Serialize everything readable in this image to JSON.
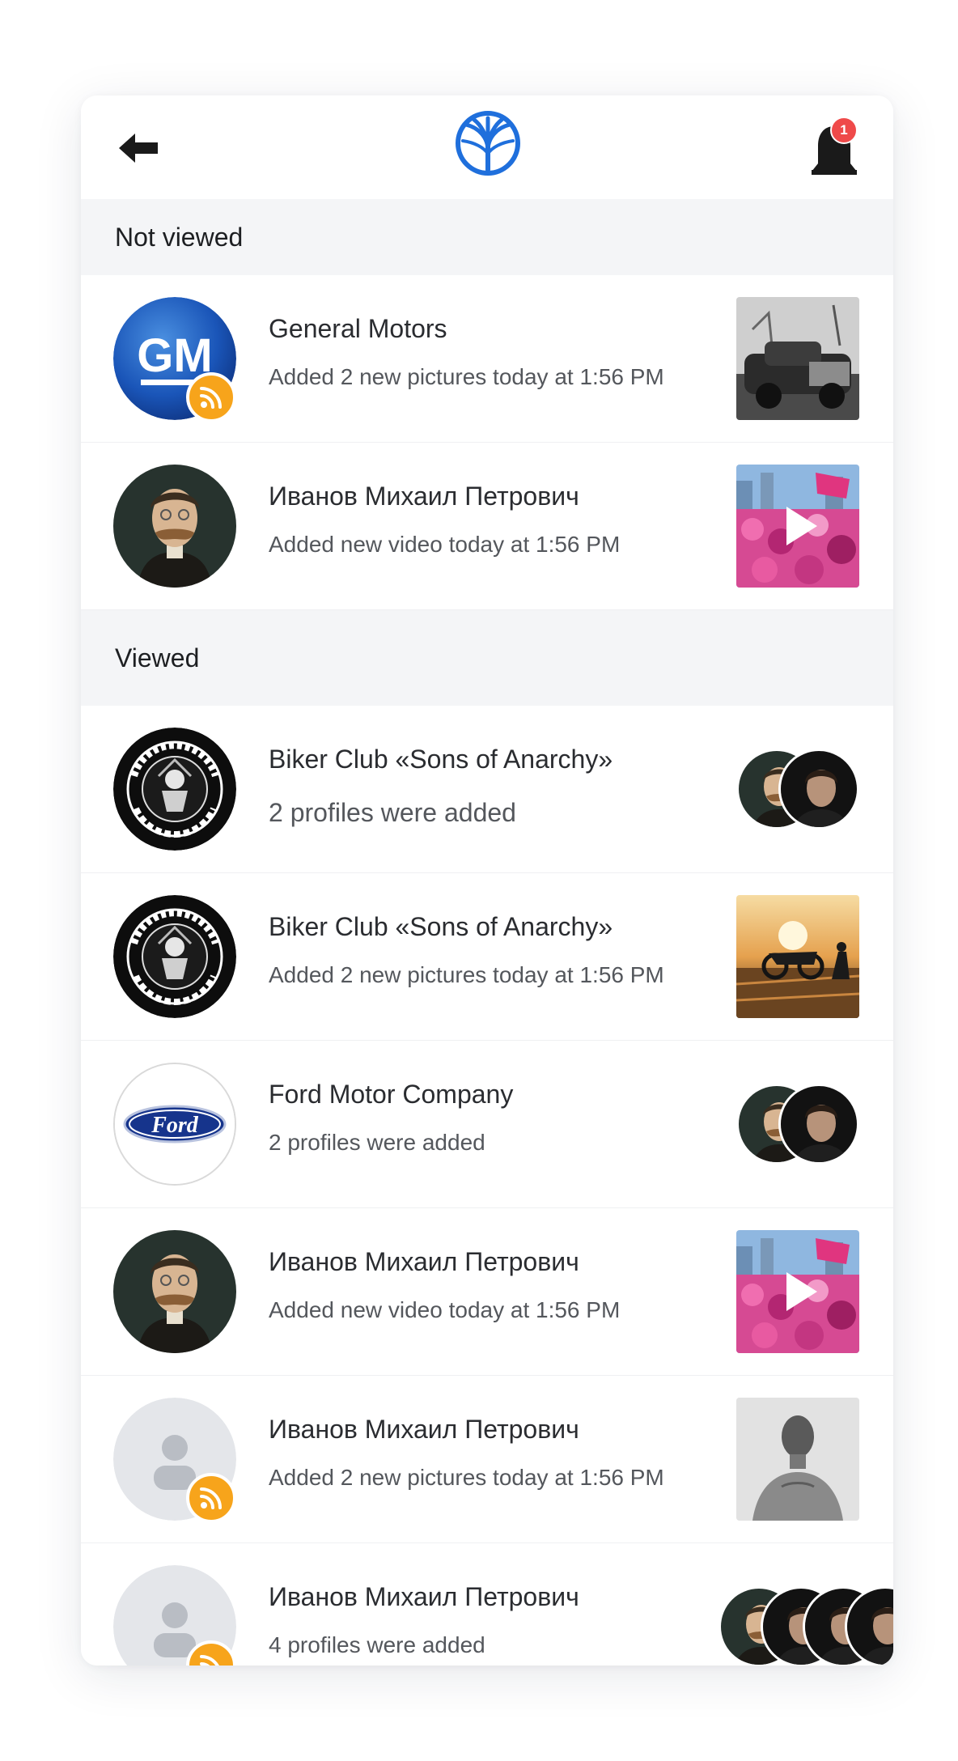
{
  "colors": {
    "accent": "#1f6fdc",
    "rss": "#f7a41b",
    "badge": "#ef4a4a",
    "section_bg": "#f4f5f7"
  },
  "header": {
    "back_icon": "arrow-left-icon",
    "logo_icon": "tree-logo-icon",
    "bell_icon": "bell-icon",
    "notification_count": "1"
  },
  "sections": [
    {
      "title": "Not viewed"
    },
    {
      "title": "Viewed"
    }
  ],
  "items": [
    {
      "title": "General Motors",
      "subtitle": "Added 2 new pictures today at 1:56 PM"
    },
    {
      "title": "Иванов Михаил Петрович",
      "subtitle": "Added new video today at 1:56 PM"
    },
    {
      "title": "Biker Club «Sons of Anarchy»",
      "subtitle": "2 profiles were added"
    },
    {
      "title": "Biker Club «Sons of Anarchy»",
      "subtitle": "Added 2 new pictures today at 1:56 PM"
    },
    {
      "title": "Ford Motor Company",
      "subtitle": "2 profiles were added"
    },
    {
      "title": "Иванов Михаил Петрович",
      "subtitle": "Added new video today at 1:56 PM"
    },
    {
      "title": "Иванов Михаил Петрович",
      "subtitle": "Added 2 new pictures today at 1:56 PM"
    },
    {
      "title": "Иванов Михаил Петрович",
      "subtitle": "4 profiles were added"
    }
  ],
  "logos": {
    "gm": "GM",
    "ford": "Ford"
  }
}
